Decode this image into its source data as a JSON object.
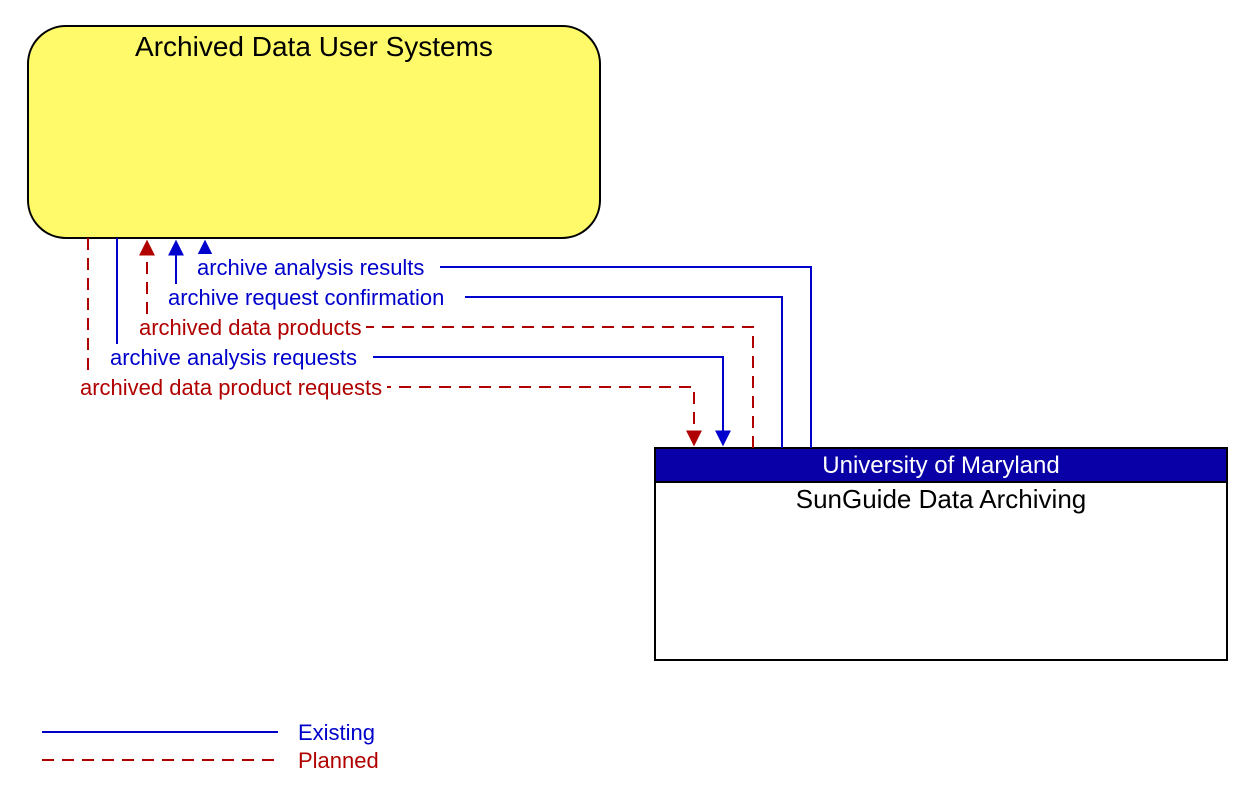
{
  "nodes": {
    "source": {
      "title": "Archived Data User Systems"
    },
    "target": {
      "header": "University of Maryland",
      "title": "SunGuide Data Archiving"
    }
  },
  "flows": {
    "f1": {
      "label": "archive analysis results",
      "status": "existing"
    },
    "f2": {
      "label": "archive request confirmation",
      "status": "existing"
    },
    "f3": {
      "label": "archived data products",
      "status": "planned"
    },
    "f4": {
      "label": "archive analysis requests",
      "status": "existing"
    },
    "f5": {
      "label": "archived data product requests",
      "status": "planned"
    }
  },
  "legend": {
    "existing": "Existing",
    "planned": "Planned"
  },
  "colors": {
    "existing": "#0000cc",
    "planned": "#b00000",
    "yellow": "#fffa6a",
    "header": "#0900a8"
  }
}
